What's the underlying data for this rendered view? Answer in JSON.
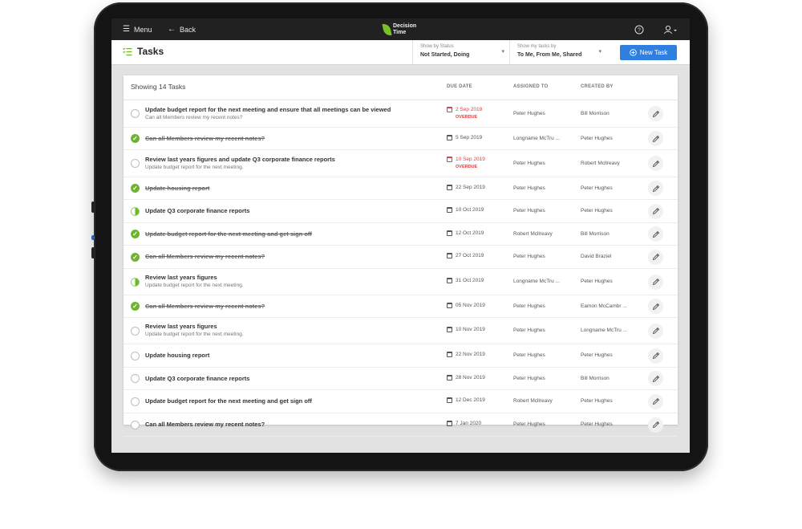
{
  "topbar": {
    "menu_label": "Menu",
    "back_label": "Back",
    "brand_line1": "Decision",
    "brand_line2": "Time"
  },
  "header": {
    "title": "Tasks",
    "status_filter": {
      "label": "Show by Status",
      "value": "Not Started,  Doing"
    },
    "mine_filter": {
      "label": "Show my tasks by",
      "value": "To Me,  From Me,  Shared"
    },
    "new_task_label": "New Task"
  },
  "table": {
    "showing": "Showing 14 Tasks",
    "col_due": "DUE DATE",
    "col_assigned": "ASSIGNED TO",
    "col_created": "CREATED BY",
    "overdue_label": "OVERDUE",
    "rows": [
      {
        "title": "Update budget report for the next meeting and ensure that all meetings can be viewed",
        "subtitle": "Can all Members review my recent notes?",
        "status": "open",
        "due": "2 Sep 2019",
        "overdue": true,
        "assigned": "Peter Hughes",
        "created": "Bill Morrison"
      },
      {
        "title": "Can all Members review my recent notes?",
        "status": "done",
        "due": "5 Sep 2019",
        "overdue": false,
        "assigned": "Longname McTru ...",
        "created": "Peter Hughes"
      },
      {
        "title": "Review last years figures and update Q3 corporate finance reports",
        "subtitle": "Update budget report for the next meeting.",
        "status": "open",
        "due": "10 Sep 2019",
        "overdue": true,
        "assigned": "Peter Hughes",
        "created": "Robert Mcllreavy"
      },
      {
        "title": "Update housing report",
        "status": "done",
        "due": "22 Sep 2019",
        "overdue": false,
        "assigned": "Peter Hughes",
        "created": "Peter Hughes"
      },
      {
        "title": "Update Q3 corporate finance reports",
        "status": "doing",
        "due": "10 Oct 2019",
        "overdue": false,
        "assigned": "Peter Hughes",
        "created": "Peter Hughes"
      },
      {
        "title": "Update budget report for the next meeting and get sign off",
        "status": "done",
        "due": "12 Oct 2019",
        "overdue": false,
        "assigned": "Robert Mcllreavy",
        "created": "Bill Morrison"
      },
      {
        "title": "Can all Members review my recent notes?",
        "status": "done",
        "due": "27 Oct 2019",
        "overdue": false,
        "assigned": "Peter Hughes",
        "created": "David Braziel"
      },
      {
        "title": "Review last years figures",
        "subtitle": "Update budget report for the next meeting.",
        "status": "doing",
        "due": "31 Oct 2019",
        "overdue": false,
        "assigned": "Longname McTru ...",
        "created": "Peter Hughes"
      },
      {
        "title": "Can all Members review my recent notes?",
        "status": "done",
        "due": "05 Nov 2019",
        "overdue": false,
        "assigned": "Peter Hughes",
        "created": "Eamon McCambr ..."
      },
      {
        "title": "Review last years figures",
        "subtitle": "Update budget report for the next meeting.",
        "status": "open",
        "due": "10 Nov 2019",
        "overdue": false,
        "assigned": "Peter Hughes",
        "created": "Longname McTru ..."
      },
      {
        "title": "Update housing report",
        "status": "open",
        "due": "22 Nov 2019",
        "overdue": false,
        "assigned": "Peter Hughes",
        "created": "Peter Hughes"
      },
      {
        "title": "Update Q3 corporate finance reports",
        "status": "open",
        "due": "28 Nov 2019",
        "overdue": false,
        "assigned": "Peter Hughes",
        "created": "Bill Morrison"
      },
      {
        "title": "Update budget report for the next meeting and get sign off",
        "status": "open",
        "due": "12 Dec 2019",
        "overdue": false,
        "assigned": "Robert Mcllreavy",
        "created": "Peter Hughes"
      },
      {
        "title": "Can all Members review my recent notes?",
        "status": "open",
        "due": "7 Jan 2020",
        "overdue": false,
        "assigned": "Peter Hughes",
        "created": "Peter Hughes"
      }
    ]
  },
  "colors": {
    "accent": "#2f7fe0",
    "done": "#6cb52d",
    "overdue": "#e04040",
    "topbar": "#212121"
  },
  "icons": [
    "menu-icon",
    "back-arrow-icon",
    "help-icon",
    "user-icon",
    "tasks-list-icon",
    "plus-circle-icon",
    "calendar-icon",
    "check-icon",
    "pencil-icon"
  ]
}
